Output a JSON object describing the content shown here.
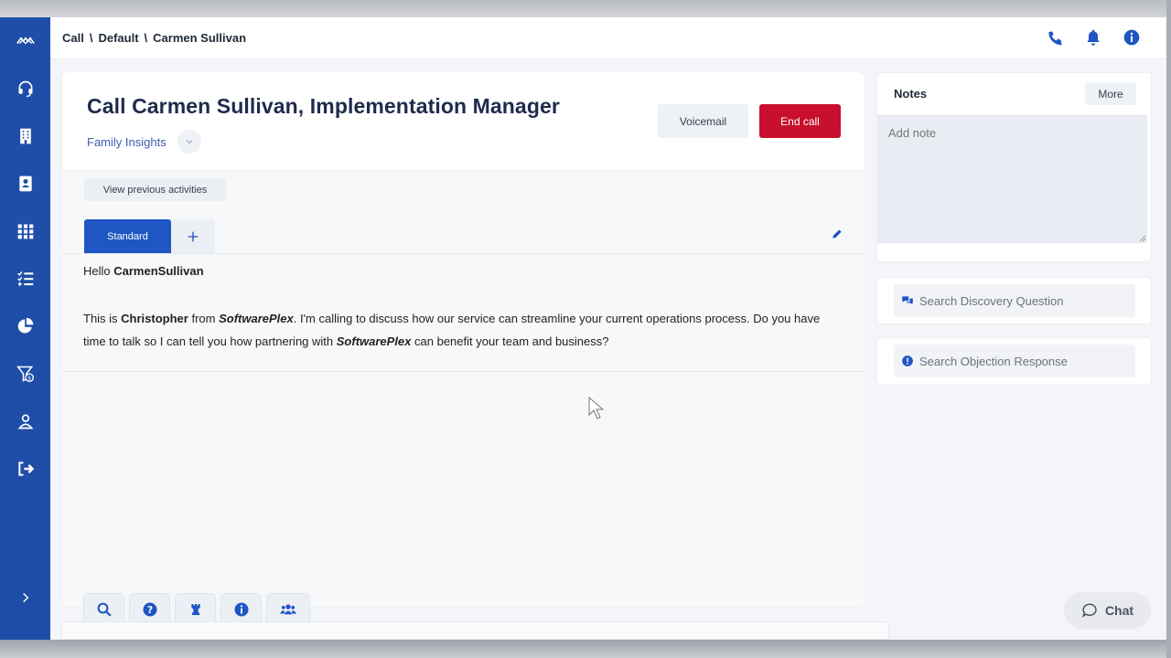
{
  "breadcrumb": {
    "level1": "Call",
    "sep1": "\\",
    "level2": "Default",
    "sep2": "\\",
    "level3": "Carmen Sullivan"
  },
  "call": {
    "title": "Call Carmen Sullivan, Implementation Manager",
    "company": "Family Insights",
    "voicemail_label": "Voicemail",
    "end_call_label": "End call",
    "view_previous_label": "View previous activities"
  },
  "tabs": {
    "standard_label": "Standard",
    "add_symbol": "+"
  },
  "script": {
    "greeting_prefix": "Hello ",
    "greeting_name": "CarmenSullivan",
    "p2_part1": "This is ",
    "caller": "Christopher",
    "p2_part2": " from ",
    "brand": "SoftwarePlex",
    "p2_part3": ". I'm calling to discuss how our service can streamline your current operations process. Do you have time to talk so I can tell you how partnering with ",
    "p2_part4": " can benefit your team and business?"
  },
  "notes": {
    "title": "Notes",
    "more_label": "More",
    "placeholder": "Add note"
  },
  "search": {
    "discovery_placeholder": "Search Discovery Question",
    "objection_placeholder": "Search Objection Response"
  },
  "chat": {
    "label": "Chat"
  },
  "icons": {
    "sidebar": [
      "logo-icon",
      "headset-icon",
      "building-icon",
      "contacts-icon",
      "grid-icon",
      "tasks-icon",
      "pie-chart-icon",
      "funnel-icon",
      "user-icon",
      "logout-icon",
      "chevron-right-icon"
    ],
    "topbar": [
      "phone-icon",
      "bell-icon",
      "info-icon"
    ],
    "bottom_tabs": [
      "search-icon",
      "question-icon",
      "chess-rook-icon",
      "info-icon",
      "users-icon"
    ]
  },
  "colors": {
    "sidebar": "#1f4ea8",
    "accent": "#1f56c3",
    "danger": "#c8102e",
    "title": "#1e2b4d"
  }
}
